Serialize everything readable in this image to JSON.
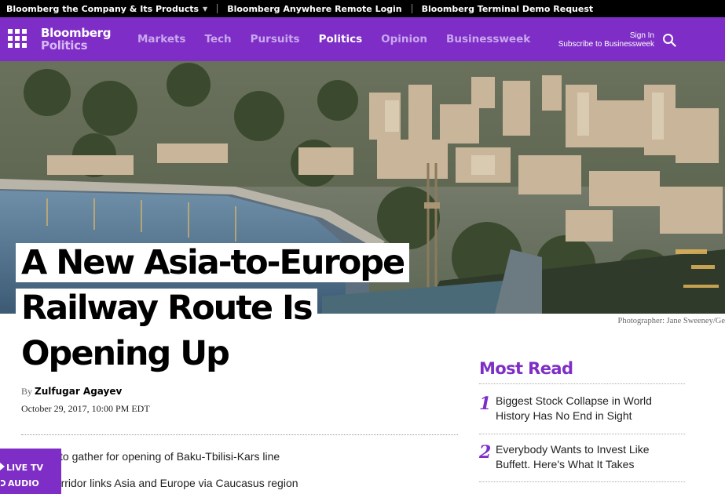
{
  "topbar": {
    "links": [
      "Bloomberg the Company & Its Products",
      "Bloomberg Anywhere Remote Login",
      "Bloomberg Terminal Demo Request"
    ]
  },
  "nav": {
    "brand_line1": "Bloomberg",
    "brand_line2": "Politics",
    "links": [
      "Markets",
      "Tech",
      "Pursuits",
      "Politics",
      "Opinion",
      "Businessweek"
    ],
    "active": "Politics",
    "signin": "Sign In",
    "subscribe": "Subscribe to Businessweek"
  },
  "article": {
    "headline_lines": [
      "A New Asia-to-Europe",
      "Railway Route Is",
      "Opening Up"
    ],
    "photo_credit": "Photographer: Jane Sweeney/Ge",
    "byline_prefix": "By",
    "author": "Zulfugar Agayev",
    "date": "October 29, 2017, 10:00 PM EDT",
    "bullets": [
      "esidents to gather for opening of Baku-Tbilisi-Kars line",
      "nsport corridor links Asia and Europe via Caucasus region"
    ]
  },
  "live_tv": {
    "live_label": "LIVE TV",
    "audio_label": "AUDIO"
  },
  "most_read": {
    "title": "Most Read",
    "items": [
      {
        "num": "1",
        "text": "Biggest Stock Collapse in World History Has No End in Sight"
      },
      {
        "num": "2",
        "text": "Everybody Wants to Invest Like Buffett. Here's What It Takes"
      }
    ]
  },
  "colors": {
    "brand_purple": "#7e2ec6",
    "nav_link_inactive": "#c9a8ee",
    "topbar_bg": "#000000"
  }
}
